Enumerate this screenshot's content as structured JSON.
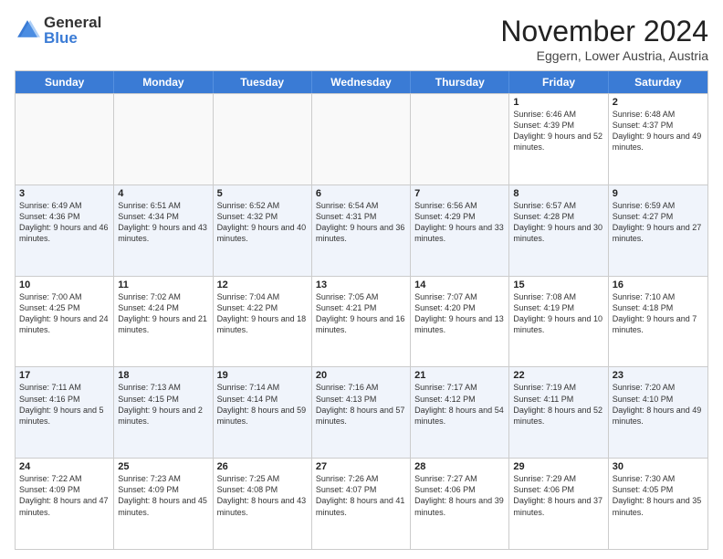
{
  "logo": {
    "general": "General",
    "blue": "Blue"
  },
  "header": {
    "month": "November 2024",
    "location": "Eggern, Lower Austria, Austria"
  },
  "weekdays": [
    "Sunday",
    "Monday",
    "Tuesday",
    "Wednesday",
    "Thursday",
    "Friday",
    "Saturday"
  ],
  "rows": [
    [
      {
        "day": "",
        "info": "",
        "empty": true
      },
      {
        "day": "",
        "info": "",
        "empty": true
      },
      {
        "day": "",
        "info": "",
        "empty": true
      },
      {
        "day": "",
        "info": "",
        "empty": true
      },
      {
        "day": "",
        "info": "",
        "empty": true
      },
      {
        "day": "1",
        "info": "Sunrise: 6:46 AM\nSunset: 4:39 PM\nDaylight: 9 hours and 52 minutes.",
        "empty": false
      },
      {
        "day": "2",
        "info": "Sunrise: 6:48 AM\nSunset: 4:37 PM\nDaylight: 9 hours and 49 minutes.",
        "empty": false
      }
    ],
    [
      {
        "day": "3",
        "info": "Sunrise: 6:49 AM\nSunset: 4:36 PM\nDaylight: 9 hours and 46 minutes.",
        "empty": false
      },
      {
        "day": "4",
        "info": "Sunrise: 6:51 AM\nSunset: 4:34 PM\nDaylight: 9 hours and 43 minutes.",
        "empty": false
      },
      {
        "day": "5",
        "info": "Sunrise: 6:52 AM\nSunset: 4:32 PM\nDaylight: 9 hours and 40 minutes.",
        "empty": false
      },
      {
        "day": "6",
        "info": "Sunrise: 6:54 AM\nSunset: 4:31 PM\nDaylight: 9 hours and 36 minutes.",
        "empty": false
      },
      {
        "day": "7",
        "info": "Sunrise: 6:56 AM\nSunset: 4:29 PM\nDaylight: 9 hours and 33 minutes.",
        "empty": false
      },
      {
        "day": "8",
        "info": "Sunrise: 6:57 AM\nSunset: 4:28 PM\nDaylight: 9 hours and 30 minutes.",
        "empty": false
      },
      {
        "day": "9",
        "info": "Sunrise: 6:59 AM\nSunset: 4:27 PM\nDaylight: 9 hours and 27 minutes.",
        "empty": false
      }
    ],
    [
      {
        "day": "10",
        "info": "Sunrise: 7:00 AM\nSunset: 4:25 PM\nDaylight: 9 hours and 24 minutes.",
        "empty": false
      },
      {
        "day": "11",
        "info": "Sunrise: 7:02 AM\nSunset: 4:24 PM\nDaylight: 9 hours and 21 minutes.",
        "empty": false
      },
      {
        "day": "12",
        "info": "Sunrise: 7:04 AM\nSunset: 4:22 PM\nDaylight: 9 hours and 18 minutes.",
        "empty": false
      },
      {
        "day": "13",
        "info": "Sunrise: 7:05 AM\nSunset: 4:21 PM\nDaylight: 9 hours and 16 minutes.",
        "empty": false
      },
      {
        "day": "14",
        "info": "Sunrise: 7:07 AM\nSunset: 4:20 PM\nDaylight: 9 hours and 13 minutes.",
        "empty": false
      },
      {
        "day": "15",
        "info": "Sunrise: 7:08 AM\nSunset: 4:19 PM\nDaylight: 9 hours and 10 minutes.",
        "empty": false
      },
      {
        "day": "16",
        "info": "Sunrise: 7:10 AM\nSunset: 4:18 PM\nDaylight: 9 hours and 7 minutes.",
        "empty": false
      }
    ],
    [
      {
        "day": "17",
        "info": "Sunrise: 7:11 AM\nSunset: 4:16 PM\nDaylight: 9 hours and 5 minutes.",
        "empty": false
      },
      {
        "day": "18",
        "info": "Sunrise: 7:13 AM\nSunset: 4:15 PM\nDaylight: 9 hours and 2 minutes.",
        "empty": false
      },
      {
        "day": "19",
        "info": "Sunrise: 7:14 AM\nSunset: 4:14 PM\nDaylight: 8 hours and 59 minutes.",
        "empty": false
      },
      {
        "day": "20",
        "info": "Sunrise: 7:16 AM\nSunset: 4:13 PM\nDaylight: 8 hours and 57 minutes.",
        "empty": false
      },
      {
        "day": "21",
        "info": "Sunrise: 7:17 AM\nSunset: 4:12 PM\nDaylight: 8 hours and 54 minutes.",
        "empty": false
      },
      {
        "day": "22",
        "info": "Sunrise: 7:19 AM\nSunset: 4:11 PM\nDaylight: 8 hours and 52 minutes.",
        "empty": false
      },
      {
        "day": "23",
        "info": "Sunrise: 7:20 AM\nSunset: 4:10 PM\nDaylight: 8 hours and 49 minutes.",
        "empty": false
      }
    ],
    [
      {
        "day": "24",
        "info": "Sunrise: 7:22 AM\nSunset: 4:09 PM\nDaylight: 8 hours and 47 minutes.",
        "empty": false
      },
      {
        "day": "25",
        "info": "Sunrise: 7:23 AM\nSunset: 4:09 PM\nDaylight: 8 hours and 45 minutes.",
        "empty": false
      },
      {
        "day": "26",
        "info": "Sunrise: 7:25 AM\nSunset: 4:08 PM\nDaylight: 8 hours and 43 minutes.",
        "empty": false
      },
      {
        "day": "27",
        "info": "Sunrise: 7:26 AM\nSunset: 4:07 PM\nDaylight: 8 hours and 41 minutes.",
        "empty": false
      },
      {
        "day": "28",
        "info": "Sunrise: 7:27 AM\nSunset: 4:06 PM\nDaylight: 8 hours and 39 minutes.",
        "empty": false
      },
      {
        "day": "29",
        "info": "Sunrise: 7:29 AM\nSunset: 4:06 PM\nDaylight: 8 hours and 37 minutes.",
        "empty": false
      },
      {
        "day": "30",
        "info": "Sunrise: 7:30 AM\nSunset: 4:05 PM\nDaylight: 8 hours and 35 minutes.",
        "empty": false
      }
    ]
  ]
}
